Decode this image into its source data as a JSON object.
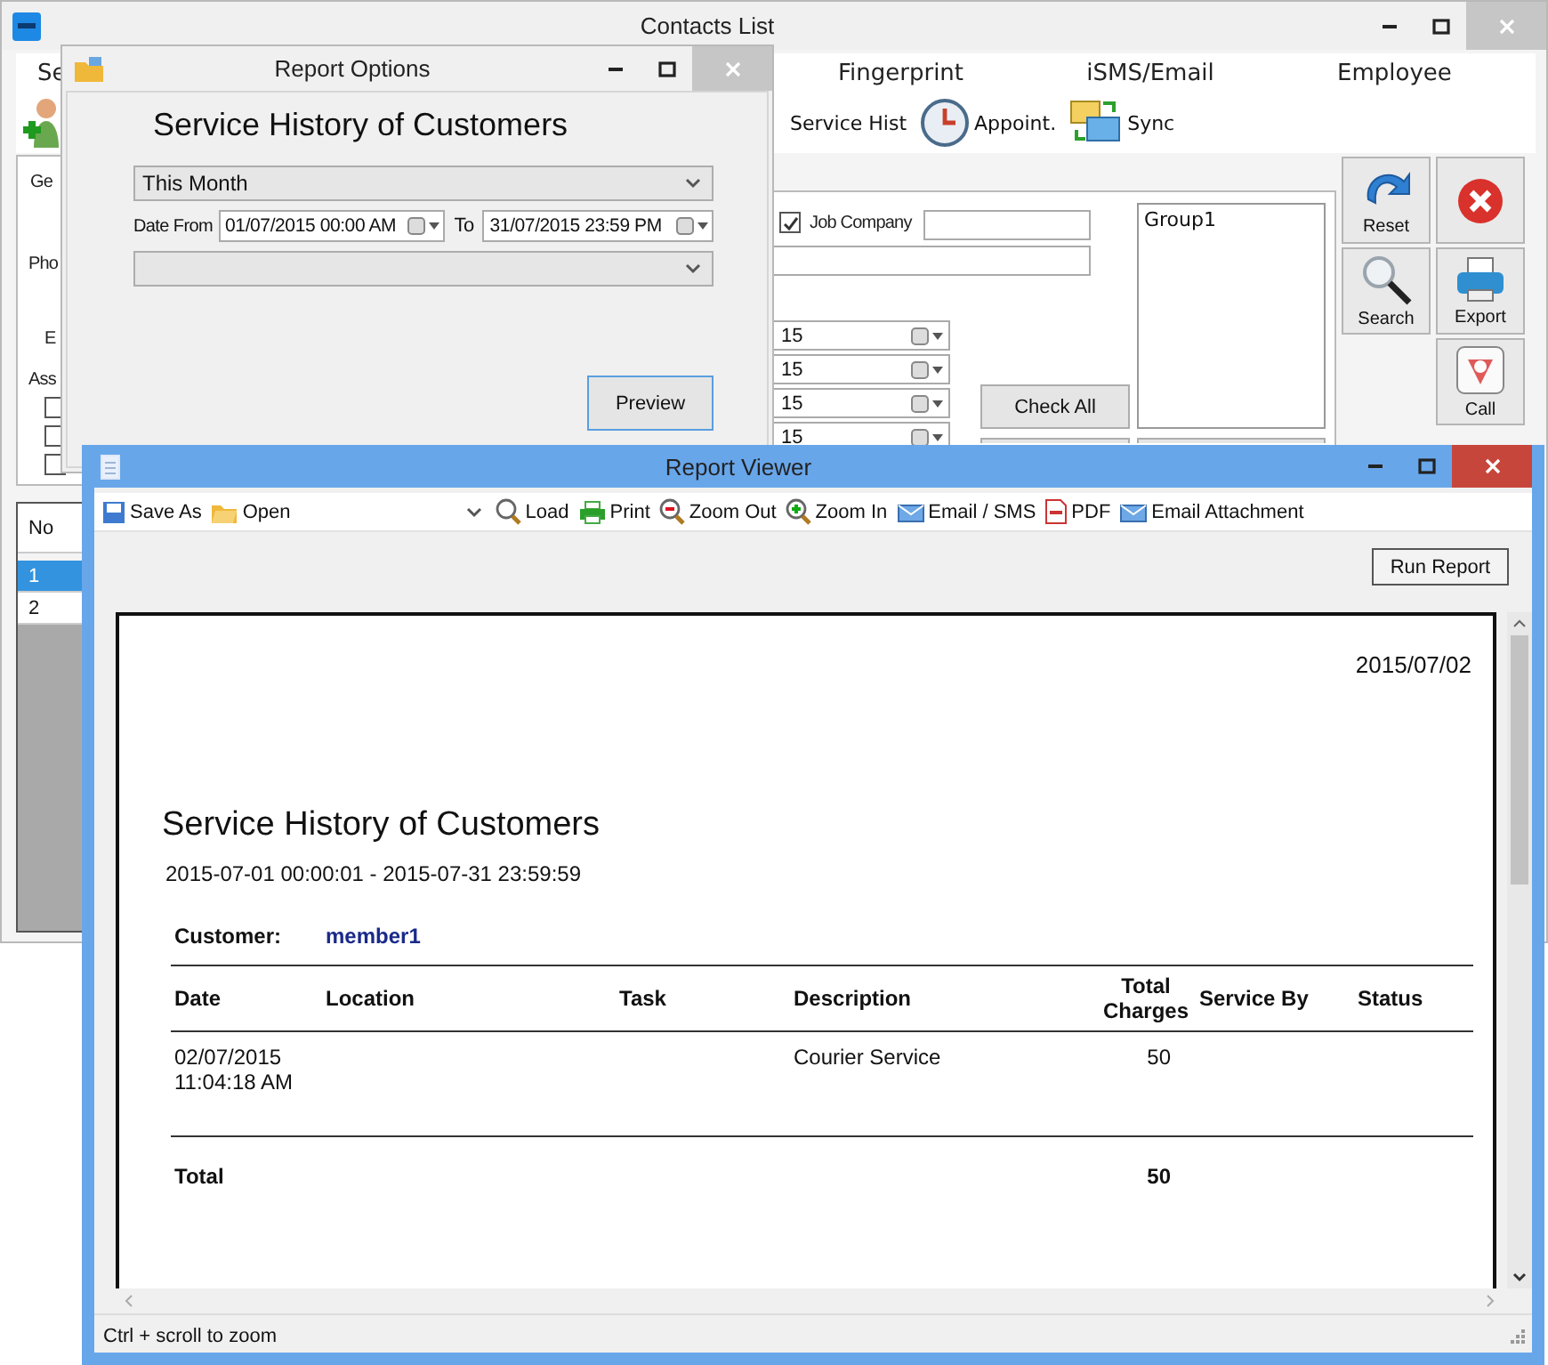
{
  "contacts_window": {
    "title": "Contacts List",
    "menu_tabs": [
      {
        "label": "Se"
      },
      {
        "label": "Fingerprint"
      },
      {
        "label": "iSMS/Email"
      },
      {
        "label": "Employee"
      }
    ],
    "toolbar": [
      {
        "kind": "history",
        "label": "Service Hist"
      },
      {
        "kind": "clock",
        "label": "Appoint."
      },
      {
        "kind": "sync",
        "label": "Sync"
      }
    ],
    "form_labels": [
      "Ge",
      "Pho",
      "E",
      "Ass"
    ],
    "assign_checkboxes": [
      {
        "checked": false
      },
      {
        "checked": false
      },
      {
        "checked": false
      }
    ],
    "job_company": {
      "checked": true,
      "label": "Job Company"
    },
    "date_fields": [
      {
        "value": "15"
      },
      {
        "value": "15"
      },
      {
        "value": "15"
      },
      {
        "value": "15"
      }
    ],
    "check_all_button": "Check All",
    "group_list": [
      "Group1"
    ],
    "side_buttons": [
      {
        "kind": "reset",
        "label": "Reset"
      },
      {
        "kind": "close"
      },
      {
        "kind": "search",
        "label": "Search"
      },
      {
        "kind": "export",
        "label": "Export"
      },
      {
        "kind": "call",
        "label": "Call"
      }
    ],
    "grid": {
      "columns": [
        "No"
      ],
      "rows": [
        {
          "cells": [
            "1"
          ],
          "selected": true
        },
        {
          "cells": [
            "2"
          ],
          "selected": false
        }
      ]
    }
  },
  "report_options": {
    "title": "Report Options",
    "heading": "Service History of Customers",
    "period": "This Month",
    "date_from_label": "Date From",
    "date_from": "01/07/2015 00:00 AM",
    "to_label": "To",
    "date_to": "31/07/2015 23:59 PM",
    "button": "Preview"
  },
  "report_viewer": {
    "title": "Report Viewer",
    "toolbar": [
      {
        "kind": "save",
        "label": "Save As"
      },
      {
        "kind": "open",
        "label": "Open"
      },
      {
        "kind": "combo"
      },
      {
        "kind": "load",
        "label": "Load"
      },
      {
        "kind": "print",
        "label": "Print"
      },
      {
        "kind": "zoom-out",
        "label": "Zoom Out"
      },
      {
        "kind": "zoom-in",
        "label": "Zoom In"
      },
      {
        "kind": "email",
        "label": "Email / SMS"
      },
      {
        "kind": "pdf",
        "label": "PDF"
      },
      {
        "kind": "email",
        "label": "Email Attachment"
      }
    ],
    "run_button": "Run Report",
    "report": {
      "printed_date": "2015/07/02",
      "title": "Service History of Customers",
      "range": "2015-07-01 00:00:01 - 2015-07-31 23:59:59",
      "customer_label": "Customer:",
      "customer": "member1",
      "columns": [
        "Date",
        "Location",
        "Task",
        "Description",
        "Total Charges",
        "Service By",
        "Status"
      ],
      "rows": [
        {
          "date": "02/07/2015 11:04:18 AM",
          "description": "Courier Service",
          "total_charges": "50"
        }
      ],
      "total": {
        "label": "Total",
        "total_charges": "50"
      }
    },
    "status_bar": "Ctrl + scroll to zoom"
  }
}
